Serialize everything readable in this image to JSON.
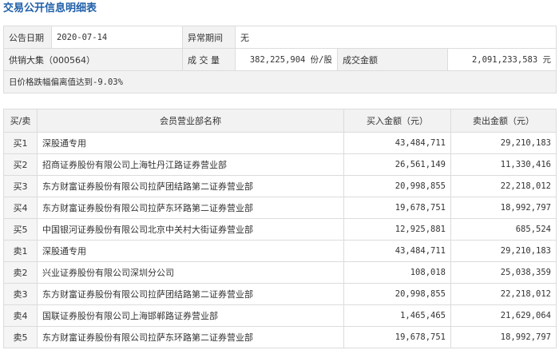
{
  "title": "交易公开信息明细表",
  "info": {
    "date_label": "公告日期",
    "date_value": "2020-07-14",
    "abnormal_label": "异常期间",
    "abnormal_value": "无",
    "stock": "供销大集（000564）",
    "volume_label": "成 交 量",
    "volume_value": "382,225,904 份/股",
    "amount_label": "成交金额",
    "amount_value": "2,091,233,583 元",
    "reason": "日价格跌幅偏离值达到-9.03%"
  },
  "table": {
    "headers": [
      "买/卖",
      "会员营业部名称",
      "买入金额（元）",
      "卖出金额（元）"
    ],
    "rows": [
      {
        "side": "买1",
        "name": "深股通专用",
        "buy": "43,484,711",
        "sell": "29,210,183"
      },
      {
        "side": "买2",
        "name": "招商证券股份有限公司上海牡丹江路证券营业部",
        "buy": "26,561,149",
        "sell": "11,330,416"
      },
      {
        "side": "买3",
        "name": "东方财富证券股份有限公司拉萨团结路第二证券营业部",
        "buy": "20,998,855",
        "sell": "22,218,012"
      },
      {
        "side": "买4",
        "name": "东方财富证券股份有限公司拉萨东环路第二证券营业部",
        "buy": "19,678,751",
        "sell": "18,992,797"
      },
      {
        "side": "买5",
        "name": "中国银河证券股份有限公司北京中关村大街证券营业部",
        "buy": "12,925,881",
        "sell": "685,524"
      },
      {
        "side": "卖1",
        "name": "深股通专用",
        "buy": "43,484,711",
        "sell": "29,210,183"
      },
      {
        "side": "卖2",
        "name": "兴业证券股份有限公司深圳分公司",
        "buy": "108,018",
        "sell": "25,038,359"
      },
      {
        "side": "卖3",
        "name": "东方财富证券股份有限公司拉萨团结路第二证券营业部",
        "buy": "20,998,855",
        "sell": "22,218,012"
      },
      {
        "side": "卖4",
        "name": "国联证券股份有限公司上海邯郸路证券营业部",
        "buy": "1,465,465",
        "sell": "21,629,064"
      },
      {
        "side": "卖5",
        "name": "东方财富证券股份有限公司拉萨东环路第二证券营业部",
        "buy": "19,678,751",
        "sell": "18,992,797"
      }
    ]
  }
}
